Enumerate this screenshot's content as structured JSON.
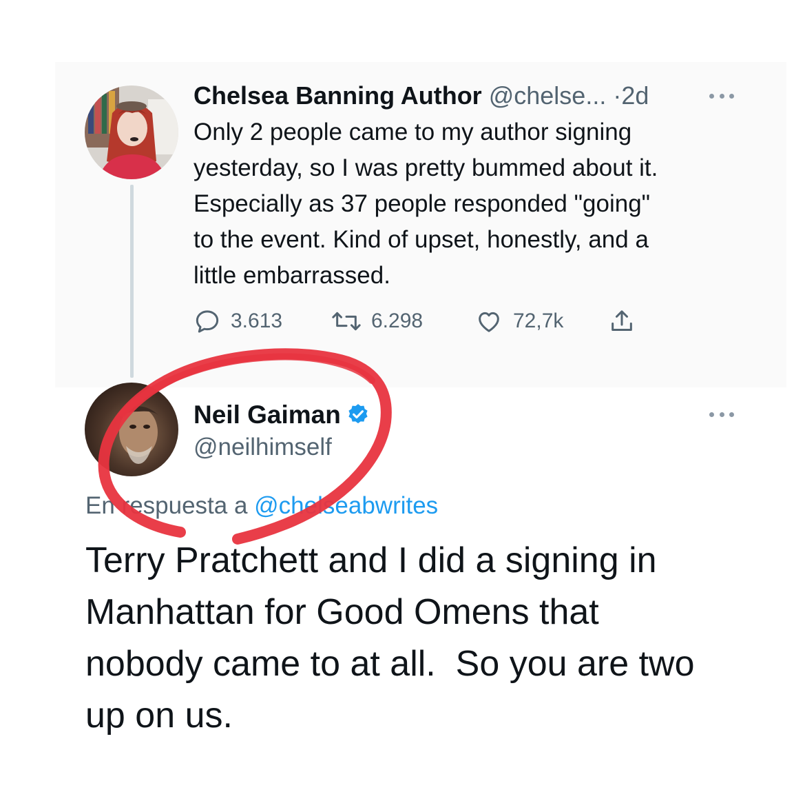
{
  "tweet1": {
    "author_name": "Chelsea Banning Author",
    "author_handle": "@chelse...",
    "separator": "·",
    "time": "2d",
    "lines": [
      "Only 2 people came to my author signing",
      "yesterday, so I was pretty bummed about it.",
      "Especially as 37 people responded \"going\"",
      "to the event. Kind of upset, honestly, and a",
      "little embarrassed."
    ],
    "replies": "3.613",
    "retweets": "6.298",
    "likes": "72,7k"
  },
  "tweet2": {
    "author_name": "Neil Gaiman",
    "author_handle": "@neilhimself",
    "reply_prefix": "En respuesta a ",
    "reply_to": "@chelseabwrites",
    "lines": [
      "Terry Pratchett and I did a signing in",
      "Manhattan for Good Omens that",
      "nobody came to at all.  So you are two",
      "up on us."
    ]
  },
  "colors": {
    "text": "#0f1419",
    "muted": "#536471",
    "link": "#1d9bf0",
    "thread_line": "#cfd9de",
    "annotation_circle": "#e8343f"
  },
  "icons": [
    "reply-icon",
    "retweet-icon",
    "like-icon",
    "share-icon",
    "more-icon",
    "verified-badge-icon"
  ]
}
